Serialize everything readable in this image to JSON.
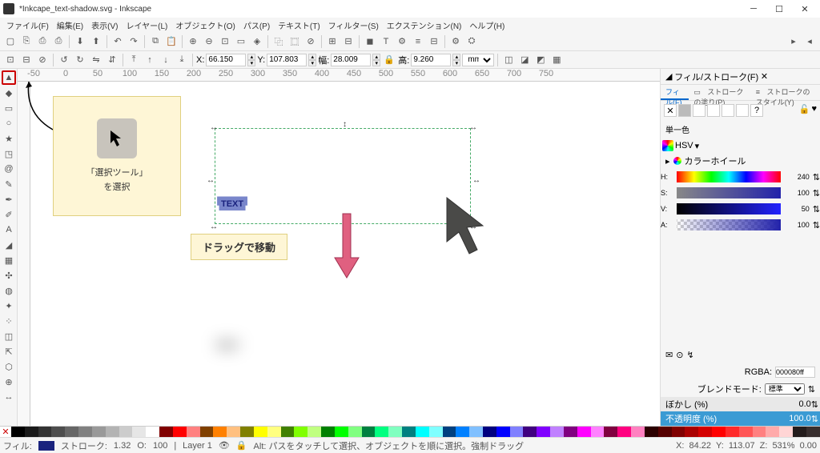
{
  "title": "*Inkcape_text-shadow.svg - Inkscape",
  "menu": {
    "file": "ファイル(F)",
    "edit": "編集(E)",
    "view": "表示(V)",
    "layer": "レイヤー(L)",
    "object": "オブジェクト(O)",
    "path": "パス(P)",
    "text": "テキスト(T)",
    "filters": "フィルター(S)",
    "extensions": "エクステンション(N)",
    "help": "ヘルプ(H)"
  },
  "coords": {
    "x_label": "X:",
    "x": "66.150",
    "y_label": "Y:",
    "y": "107.803",
    "w_label": "幅:",
    "w": "28.009",
    "h_label": "高:",
    "h": "9.260",
    "unit": "mm"
  },
  "ruler": [
    "-50",
    "0",
    "50",
    "100",
    "150",
    "200",
    "250",
    "300",
    "350",
    "400",
    "450",
    "500",
    "550",
    "600",
    "650",
    "700",
    "750"
  ],
  "callout": {
    "line1": "「選択ツール」",
    "line2": "を選択"
  },
  "drag_label": "ドラッグで移動",
  "text_obj": "TEXT",
  "panel": {
    "title": "フィル/ストローク(F)",
    "tab_fill": "フィル(F)",
    "tab_stroke_paint": "ストロークの塗り(P)",
    "tab_stroke_style": "ストロークのスタイル(Y)",
    "flat_color": "単一色",
    "color_wheel": "カラーホイール",
    "hsv": "HSV",
    "h": "H:",
    "h_val": "240",
    "s": "S:",
    "s_val": "100",
    "v": "V:",
    "v_val": "50",
    "a": "A:",
    "a_val": "100",
    "rgba_label": "RGBA:",
    "rgba": "000080ff",
    "blend_label": "ブレンドモード:",
    "blend": "標準",
    "blur_label": "ぼかし (%)",
    "blur_val": "0.0",
    "opacity_label": "不透明度 (%)",
    "opacity_val": "100.0"
  },
  "status": {
    "fill": "フィル:",
    "stroke": "ストローク:",
    "opacity": "O:",
    "opacity_val": "100",
    "stroke_w": "1.32",
    "layer": "Layer 1",
    "hint": "Alt: パスをタッチして選択、オブジェクトを順に選択。強制ドラッグ",
    "x": "X:",
    "x_val": "84.22",
    "y": "Y:",
    "y_val": "113.07",
    "z": "Z:",
    "z_val": "531%",
    "rot": "0.00"
  }
}
